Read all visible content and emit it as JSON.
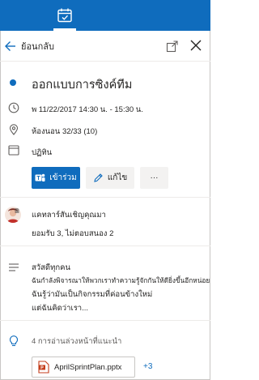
{
  "nav": {
    "back_label": "ย้อนกลับ"
  },
  "event": {
    "title": "ออกแบบการซิงค์ทีม",
    "datetime": "พ 11/22/2017 14:30 น. - 15:30 น.",
    "location": "ห้องนอน 32/33 (10)",
    "calendar": "ปฏิทิน"
  },
  "actions": {
    "join_label": "เข้าร่วม",
    "edit_label": "แก้ไข",
    "more_label": "···"
  },
  "attendees": {
    "organizer_line": "แคทลาร์สันเชิญคุณมา",
    "responses_line": "ยอมรับ 3, ไม่ตอบสนอง 2"
  },
  "notes": {
    "line1": "สวัสดีทุกคน",
    "line2": "ฉันกำลังพิจารณาให้พวกเราทำความรู้จักกันให้ดียิ่งขึ้นอีกหน่อย",
    "line3": "ฉันรู้ว่ามันเป็นกิจกรรมที่ค่อนข้างใหม่",
    "line4": "แต่ฉันคิดว่าเรา..."
  },
  "prep": {
    "heading": "4 การอ่านล่วงหน้าที่แนะนำ",
    "file_name": "AprilSprintPlan.pptx",
    "more_count": "+3"
  },
  "colors": {
    "accent": "#0f6cbd",
    "ppt": "#c43e1c"
  },
  "icons": [
    "calendar-check-icon",
    "back-arrow-icon",
    "popout-icon",
    "close-icon",
    "clock-icon",
    "location-pin-icon",
    "calendar-icon",
    "teams-icon",
    "pencil-icon",
    "notes-icon",
    "lightbulb-icon",
    "powerpoint-icon"
  ]
}
